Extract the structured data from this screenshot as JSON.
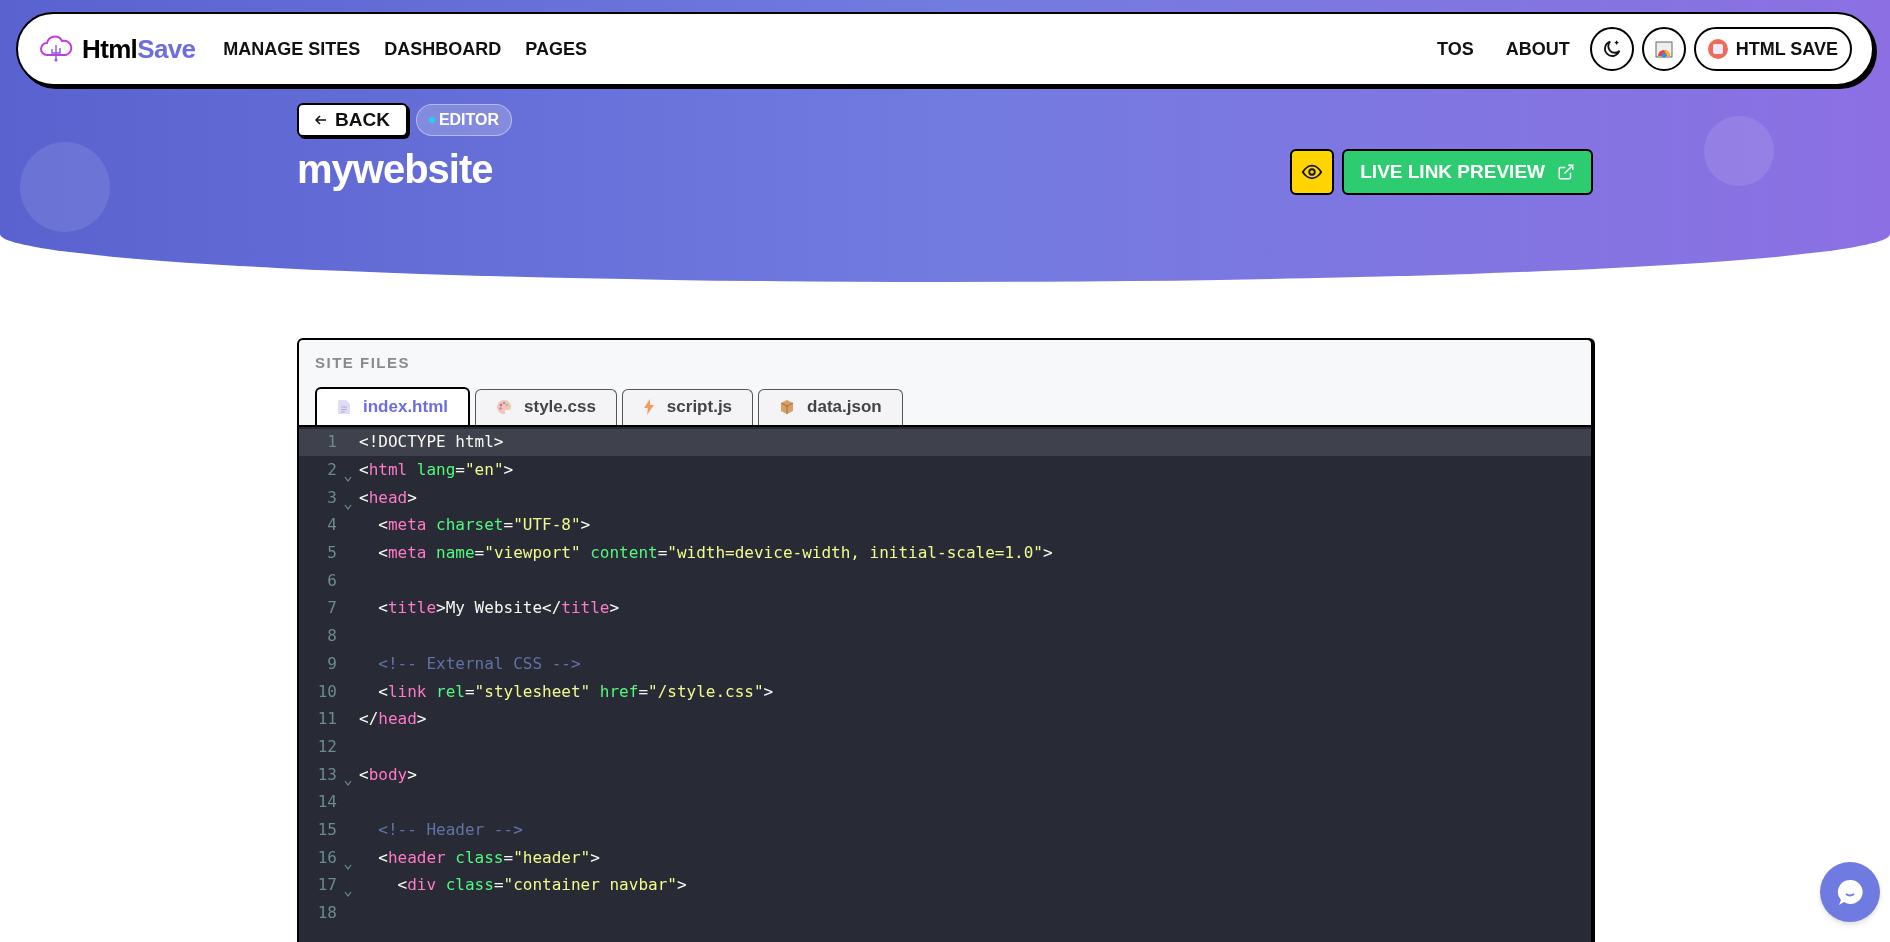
{
  "brand": {
    "first": "Html",
    "second": "Save"
  },
  "nav": {
    "links": [
      "MANAGE SITES",
      "DASHBOARD",
      "PAGES"
    ],
    "right_links": [
      "TOS",
      "ABOUT"
    ],
    "account_button": "HTML SAVE"
  },
  "hero": {
    "back_button": "BACK",
    "badge": "EDITOR",
    "title": "mywebsite",
    "preview_button": "LIVE LINK PREVIEW"
  },
  "files": {
    "heading": "SITE FILES",
    "tabs": [
      {
        "label": "index.html",
        "kind": "html",
        "selected": true
      },
      {
        "label": "style.css",
        "kind": "css",
        "selected": false
      },
      {
        "label": "script.js",
        "kind": "js",
        "selected": false
      },
      {
        "label": "data.json",
        "kind": "json",
        "selected": false
      }
    ]
  },
  "editor": {
    "lines": [
      {
        "number": "1",
        "fold": false,
        "selected": true,
        "tokens": [
          {
            "kind": "plain",
            "text": "<!DOCTYPE html>"
          }
        ]
      },
      {
        "number": "2",
        "fold": true,
        "selected": false,
        "tokens": [
          {
            "kind": "plain",
            "text": "<"
          },
          {
            "kind": "tag",
            "text": "html"
          },
          {
            "kind": "attr",
            "text": " lang"
          },
          {
            "kind": "plain",
            "text": "="
          },
          {
            "kind": "string",
            "text": "\"en\""
          },
          {
            "kind": "plain",
            "text": ">"
          }
        ]
      },
      {
        "number": "3",
        "fold": true,
        "selected": false,
        "tokens": [
          {
            "kind": "plain",
            "text": "<"
          },
          {
            "kind": "tag",
            "text": "head"
          },
          {
            "kind": "plain",
            "text": ">"
          }
        ]
      },
      {
        "number": "4",
        "fold": false,
        "selected": false,
        "tokens": [
          {
            "kind": "plain",
            "text": "  <"
          },
          {
            "kind": "tag",
            "text": "meta"
          },
          {
            "kind": "attr",
            "text": " charset"
          },
          {
            "kind": "plain",
            "text": "="
          },
          {
            "kind": "string",
            "text": "\"UTF-8\""
          },
          {
            "kind": "plain",
            "text": ">"
          }
        ]
      },
      {
        "number": "5",
        "fold": false,
        "selected": false,
        "tokens": [
          {
            "kind": "plain",
            "text": "  <"
          },
          {
            "kind": "tag",
            "text": "meta"
          },
          {
            "kind": "attr",
            "text": " name"
          },
          {
            "kind": "plain",
            "text": "="
          },
          {
            "kind": "string",
            "text": "\"viewport\""
          },
          {
            "kind": "attr",
            "text": " content"
          },
          {
            "kind": "plain",
            "text": "="
          },
          {
            "kind": "string",
            "text": "\"width=device-width, initial-scale=1.0\""
          },
          {
            "kind": "plain",
            "text": ">"
          }
        ]
      },
      {
        "number": "6",
        "fold": false,
        "selected": false
      },
      {
        "number": "7",
        "fold": false,
        "selected": false,
        "tokens": [
          {
            "kind": "plain",
            "text": "  <"
          },
          {
            "kind": "tag",
            "text": "title"
          },
          {
            "kind": "plain",
            "text": ">My Website</"
          },
          {
            "kind": "tag",
            "text": "title"
          },
          {
            "kind": "plain",
            "text": ">"
          }
        ]
      },
      {
        "number": "8",
        "fold": false,
        "selected": false
      },
      {
        "number": "9",
        "fold": false,
        "selected": false,
        "tokens": [
          {
            "kind": "comment",
            "text": "  <!-- External CSS -->"
          }
        ]
      },
      {
        "number": "10",
        "fold": false,
        "selected": false,
        "tokens": [
          {
            "kind": "plain",
            "text": "  <"
          },
          {
            "kind": "tag",
            "text": "link"
          },
          {
            "kind": "attr",
            "text": " rel"
          },
          {
            "kind": "plain",
            "text": "="
          },
          {
            "kind": "string",
            "text": "\"stylesheet\""
          },
          {
            "kind": "attr",
            "text": " href"
          },
          {
            "kind": "plain",
            "text": "="
          },
          {
            "kind": "string",
            "text": "\"/style.css\""
          },
          {
            "kind": "plain",
            "text": ">"
          }
        ]
      },
      {
        "number": "11",
        "fold": false,
        "selected": false,
        "tokens": [
          {
            "kind": "plain",
            "text": "</"
          },
          {
            "kind": "tag",
            "text": "head"
          },
          {
            "kind": "plain",
            "text": ">"
          }
        ]
      },
      {
        "number": "12",
        "fold": false,
        "selected": false
      },
      {
        "number": "13",
        "fold": true,
        "selected": false,
        "tokens": [
          {
            "kind": "plain",
            "text": "<"
          },
          {
            "kind": "tag",
            "text": "body"
          },
          {
            "kind": "plain",
            "text": ">"
          }
        ]
      },
      {
        "number": "14",
        "fold": false,
        "selected": false
      },
      {
        "number": "15",
        "fold": false,
        "selected": false,
        "tokens": [
          {
            "kind": "comment",
            "text": "  <!-- Header -->"
          }
        ]
      },
      {
        "number": "16",
        "fold": true,
        "selected": false,
        "tokens": [
          {
            "kind": "plain",
            "text": "  <"
          },
          {
            "kind": "tag",
            "text": "header"
          },
          {
            "kind": "attr",
            "text": " class"
          },
          {
            "kind": "plain",
            "text": "="
          },
          {
            "kind": "string",
            "text": "\"header\""
          },
          {
            "kind": "plain",
            "text": ">"
          }
        ]
      },
      {
        "number": "17",
        "fold": true,
        "selected": false,
        "tokens": [
          {
            "kind": "plain",
            "text": "    <"
          },
          {
            "kind": "tag",
            "text": "div"
          },
          {
            "kind": "attr",
            "text": " class"
          },
          {
            "kind": "plain",
            "text": "="
          },
          {
            "kind": "string",
            "text": "\"container navbar\""
          },
          {
            "kind": "plain",
            "text": ">"
          }
        ]
      },
      {
        "number": "18",
        "fold": false,
        "selected": false
      }
    ]
  }
}
